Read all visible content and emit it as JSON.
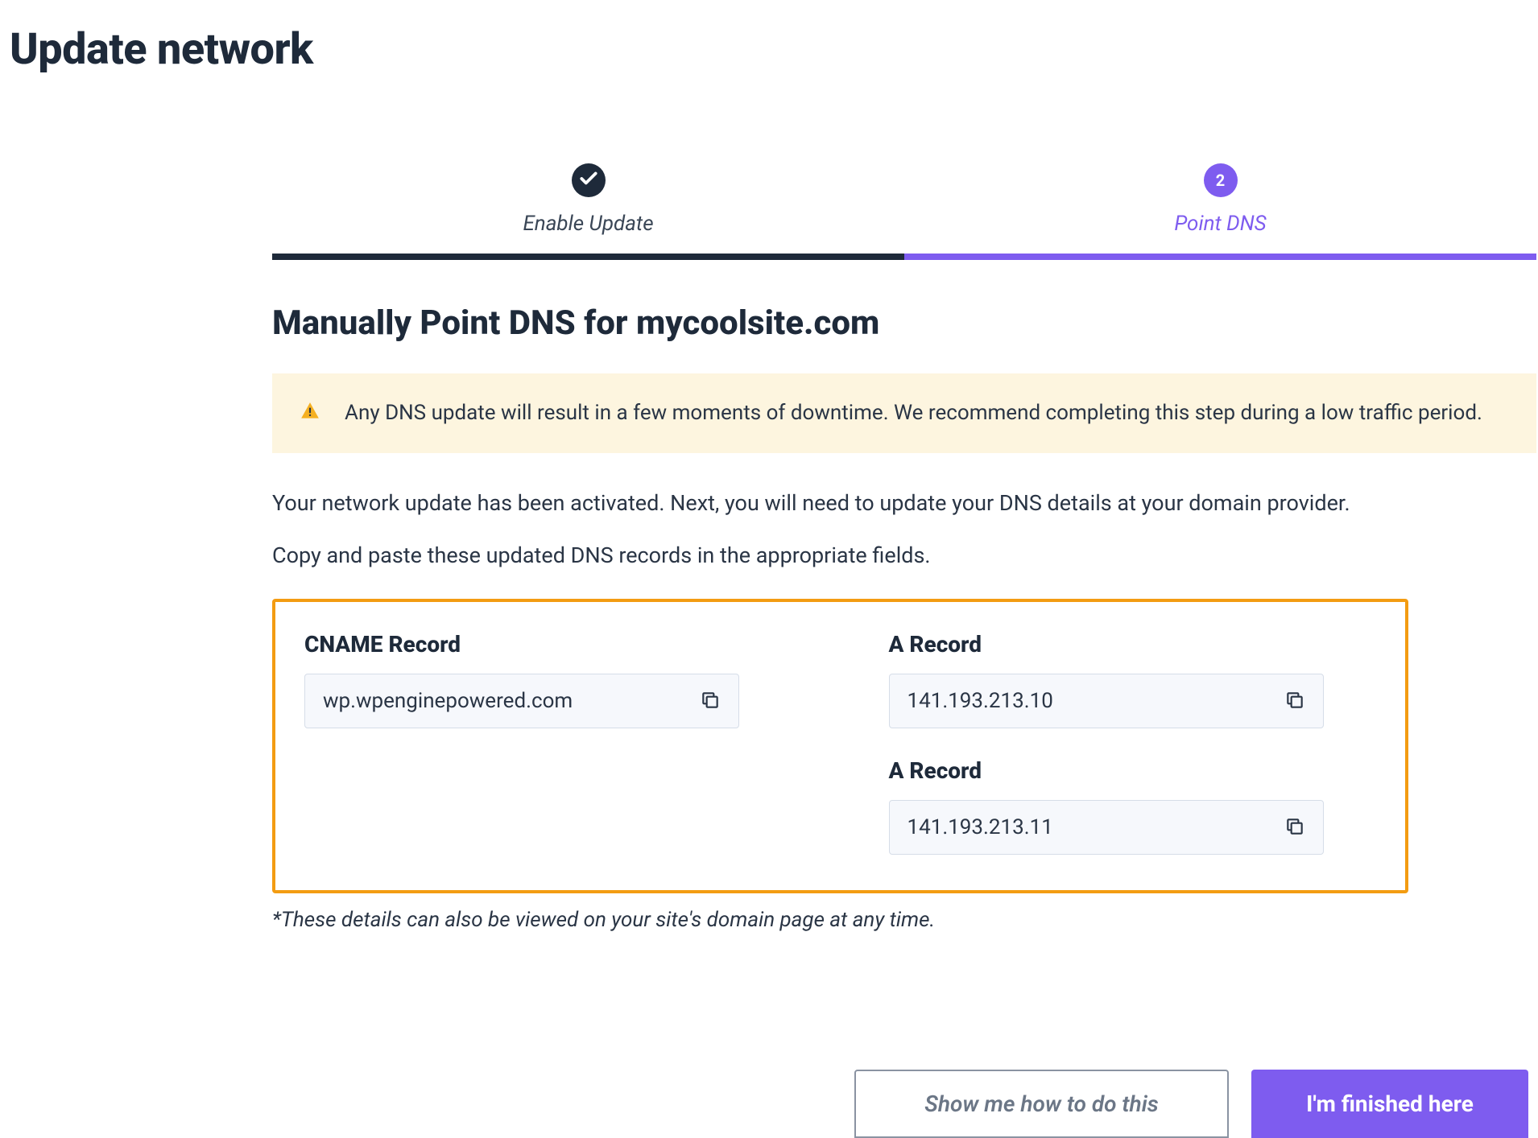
{
  "page_title": "Update network",
  "stepper": {
    "step1": {
      "label": "Enable Update",
      "status": "done"
    },
    "step2": {
      "label": "Point DNS",
      "number": "2",
      "status": "active"
    }
  },
  "section_title": "Manually Point DNS for mycoolsite.com",
  "alert": {
    "text": "Any DNS update will result in a few moments of downtime. We recommend completing this step during a low traffic period."
  },
  "body": {
    "line1": "Your network update has been activated. Next, you will need to update your DNS details at your domain provider.",
    "line2": "Copy and paste these updated DNS records in the appropriate fields."
  },
  "records": {
    "cname": {
      "label": "CNAME Record",
      "value": "wp.wpenginepowered.com"
    },
    "a1": {
      "label": "A Record",
      "value": "141.193.213.10"
    },
    "a2": {
      "label": "A Record",
      "value": "141.193.213.11"
    }
  },
  "footnote": "*These details can also be viewed on your site's domain page at any time.",
  "actions": {
    "secondary": "Show me how to do this",
    "primary": "I'm finished here"
  }
}
